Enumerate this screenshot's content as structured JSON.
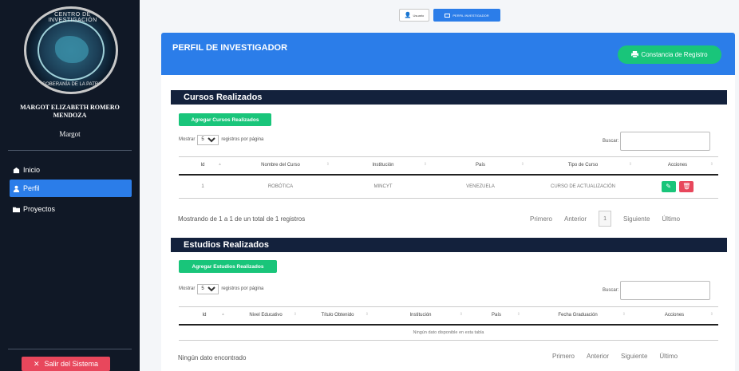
{
  "sidebar": {
    "logo_text_top": "CENTRO DE INVESTIGACIÓN",
    "logo_text_bottom": "SOBERANÍA DE LA PATRIA",
    "user_fullname": "MARGOT ELIZABETH ROMERO MENDOZA",
    "user_short": "Margot",
    "nav": [
      {
        "label": "Inicio",
        "icon": "home-icon"
      },
      {
        "label": "Perfil",
        "icon": "user-icon",
        "active": true
      },
      {
        "label": "Proyectos",
        "icon": "folder-icon"
      }
    ],
    "logout_label": "Salir del Sistema"
  },
  "topbar": {
    "user_label": "Usuario",
    "role_label": "PERFIL INVESTIGADOR"
  },
  "panel": {
    "title": "PERFIL DE INVESTIGADOR",
    "constancia_label": "Constancia de Registro"
  },
  "cursos": {
    "title": "Cursos Realizados",
    "add_label": "Agregar Cursos Realizados",
    "show_prefix": "Mostrar",
    "show_value": "5",
    "show_suffix": "registros por página",
    "search_label": "Buscar:",
    "columns": [
      "Id",
      "Nombre del Curso",
      "Institución",
      "País",
      "Tipo de Curso",
      "Acciones"
    ],
    "rows": [
      [
        "1",
        "ROBÓTICA",
        "MINCYT",
        "VENEZUELA",
        "CURSO DE ACTUALIZACIÓN"
      ]
    ],
    "info": "Mostrando de 1 a 1 de un total de 1 registros",
    "pager": {
      "first": "Primero",
      "prev": "Anterior",
      "page": "1",
      "next": "Siguiente",
      "last": "Último"
    }
  },
  "estudios": {
    "title": "Estudios Realizados",
    "add_label": "Agregar Estudios Realizados",
    "show_prefix": "Mostrar",
    "show_value": "5",
    "show_suffix": "registros por página",
    "search_label": "Buscar:",
    "columns": [
      "Id",
      "Nivel Educativo",
      "Título Obtenido",
      "Institución",
      "País",
      "Fecha Graduación",
      "Acciones"
    ],
    "empty": "Ningún dato disponible en esta tabla",
    "info": "Ningún dato encontrado",
    "pager": {
      "first": "Primero",
      "prev": "Anterior",
      "next": "Siguiente",
      "last": "Último"
    }
  }
}
